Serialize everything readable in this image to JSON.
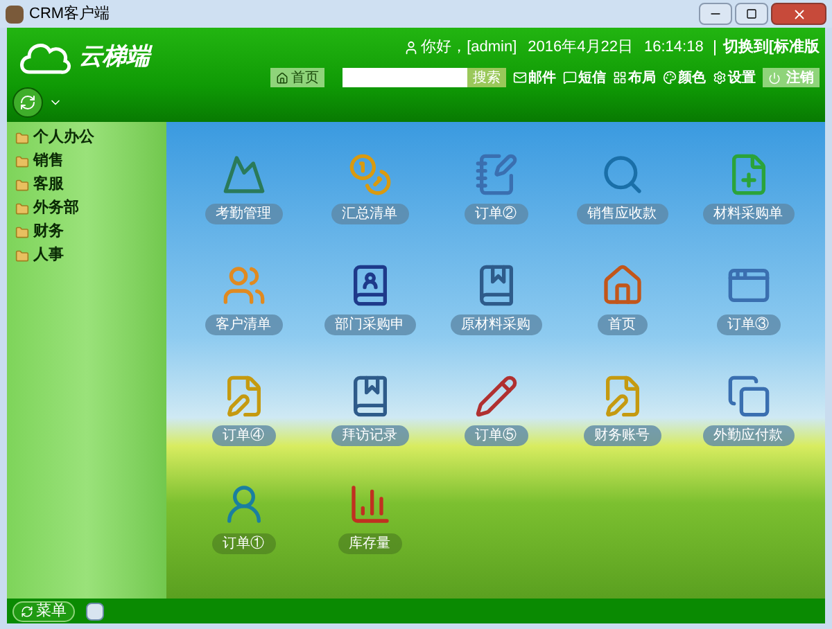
{
  "window": {
    "title": "CRM客户端"
  },
  "header": {
    "logo_text": "云梯端",
    "user_greeting": "你好，[admin]",
    "date": "2016年4月22日",
    "time": "16:14:18",
    "switch_link": "切换到[标准版"
  },
  "toolbar": {
    "home_button": "首页",
    "search": {
      "button": "搜索"
    },
    "items": [
      "邮件",
      "短信",
      "布局",
      "颜色",
      "设置"
    ],
    "logout": "注销"
  },
  "sidebar": {
    "items": [
      {
        "label": "个人办公"
      },
      {
        "label": "销售"
      },
      {
        "label": "客服"
      },
      {
        "label": "外务部"
      },
      {
        "label": "财务"
      },
      {
        "label": "人事"
      }
    ]
  },
  "desktop": {
    "shortcuts": [
      {
        "label": "考勤管理"
      },
      {
        "label": "汇总清单"
      },
      {
        "label": "订单②"
      },
      {
        "label": "销售应收款"
      },
      {
        "label": "材料采购单"
      },
      {
        "label": "客户清单"
      },
      {
        "label": "部门采购申"
      },
      {
        "label": "原材料采购"
      },
      {
        "label": "首页"
      },
      {
        "label": "订单③"
      },
      {
        "label": "订单④"
      },
      {
        "label": "拜访记录"
      },
      {
        "label": "订单⑤"
      },
      {
        "label": "财务账号"
      },
      {
        "label": "外勤应付款"
      },
      {
        "label": "订单①"
      },
      {
        "label": "库存量"
      }
    ]
  },
  "taskbar": {
    "menu_button": "菜单"
  }
}
